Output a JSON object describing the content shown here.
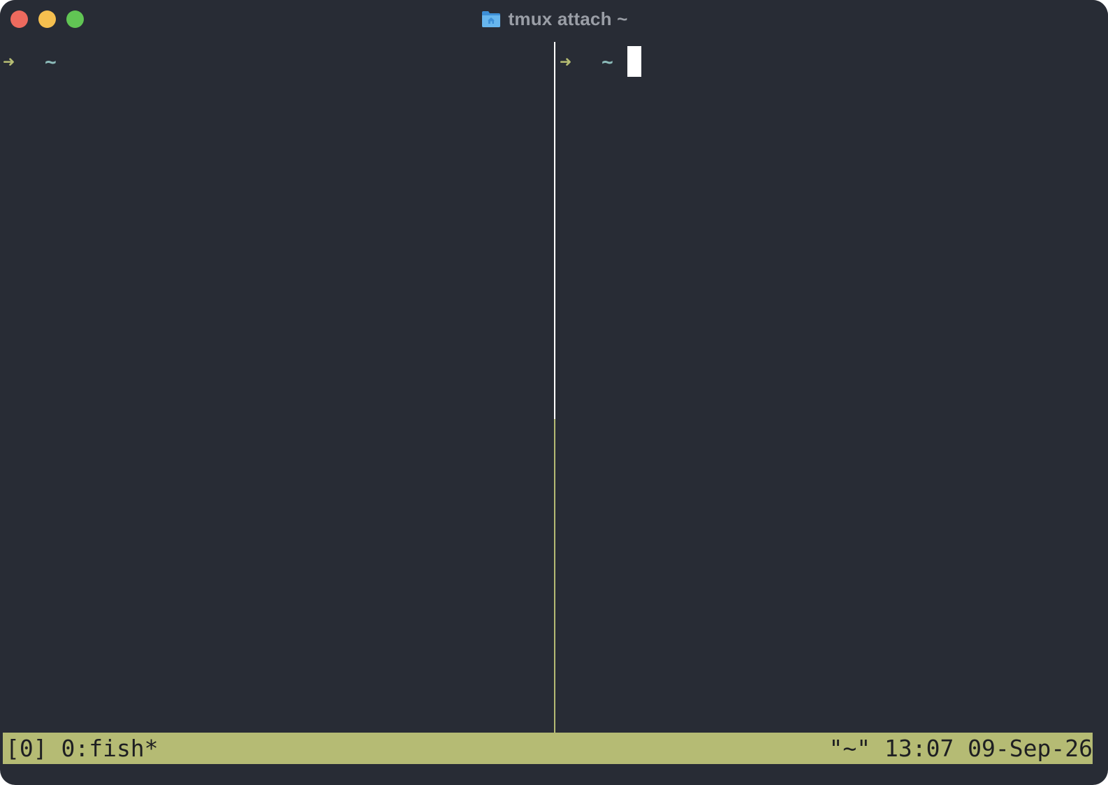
{
  "window": {
    "title": "tmux attach ~",
    "folder_icon": "home-folder-icon",
    "traffic_lights": [
      "close",
      "minimize",
      "zoom"
    ]
  },
  "panes": {
    "left": {
      "prompt_arrow": "➜",
      "prompt_dir": "~"
    },
    "right": {
      "prompt_arrow": "➜",
      "prompt_dir": "~",
      "has_cursor": true
    }
  },
  "status_bar": {
    "left": "[0] 0:fish*",
    "right": "\"~\" 13:07 09-Sep-26"
  },
  "colors": {
    "background": "#282c35",
    "status_bar": "#b5bb74",
    "prompt_arrow": "#b6bd73",
    "prompt_dir": "#8cbcba",
    "active_divider": "#ffffff"
  }
}
